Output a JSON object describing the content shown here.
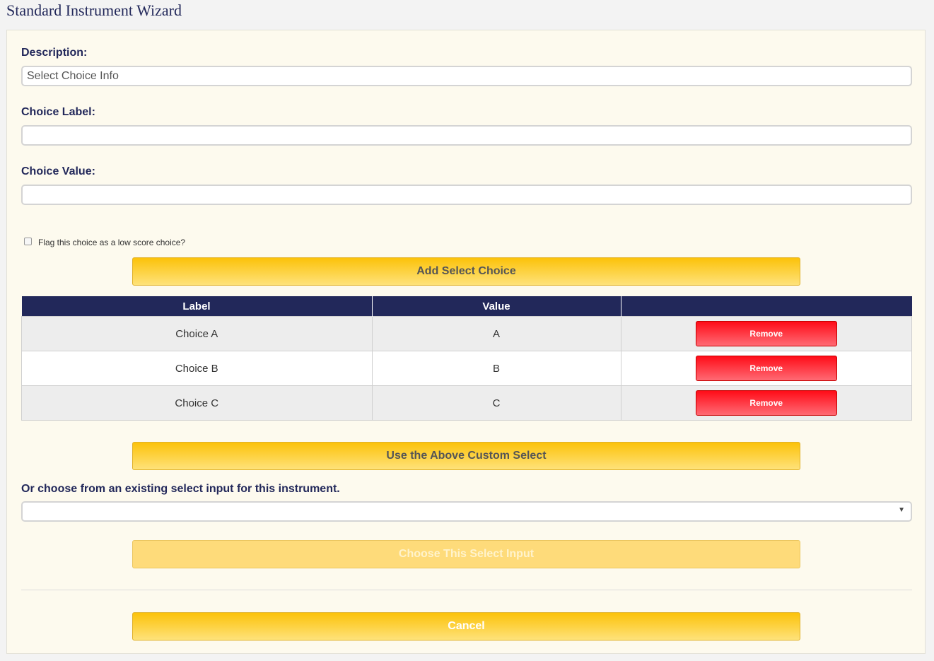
{
  "page": {
    "title": "Standard Instrument Wizard"
  },
  "form": {
    "description_label": "Description:",
    "description_value": "Select Choice Info",
    "choice_label_label": "Choice Label:",
    "choice_label_value": "",
    "choice_value_label": "Choice Value:",
    "choice_value_value": "",
    "low_score_checkbox_label": "Flag this choice as a low score choice?",
    "low_score_checked": false,
    "add_button": "Add Select Choice"
  },
  "table": {
    "headers": [
      "Label",
      "Value",
      ""
    ],
    "rows": [
      {
        "label": "Choice A",
        "value": "A",
        "action": "Remove"
      },
      {
        "label": "Choice B",
        "value": "B",
        "action": "Remove"
      },
      {
        "label": "Choice C",
        "value": "C",
        "action": "Remove"
      }
    ]
  },
  "actions": {
    "use_custom_button": "Use the Above Custom Select",
    "existing_label": "Or choose from an existing select input for this instrument.",
    "existing_selected": "",
    "choose_button": "Choose This Select Input",
    "cancel_button": "Cancel"
  },
  "colors": {
    "navy": "#22285a",
    "yellow": "#fcc20a",
    "red": "#ff0c18",
    "panel_bg": "#fdfaee"
  }
}
